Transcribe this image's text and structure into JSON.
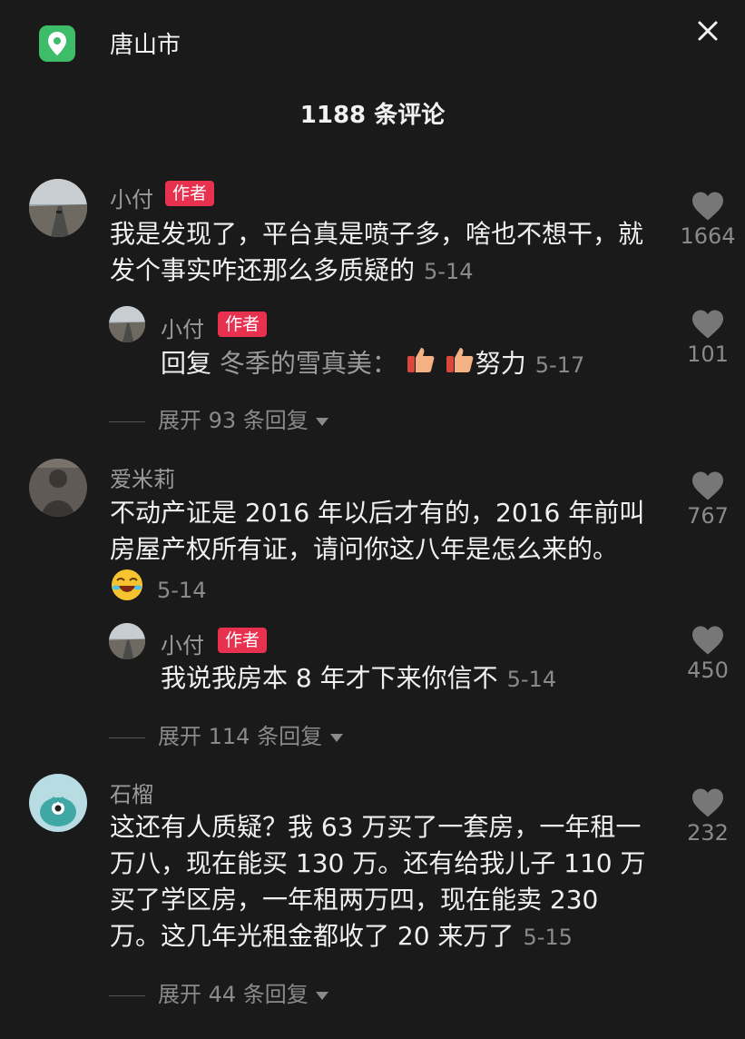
{
  "header": {
    "location": "唐山市",
    "comment_count_title": "1188 条评论"
  },
  "comments": [
    {
      "user": "小付",
      "badge": "作者",
      "text": "我是发现了，平台真是喷子多，啥也不想干，就发个事实咋还那么多质疑的",
      "date": "5-14",
      "likes": "1664",
      "reply": {
        "user": "小付",
        "badge": "作者",
        "prefix": "回复",
        "target": "冬季的雪真美：",
        "text": "努力",
        "date": "5-17",
        "likes": "101"
      },
      "expand": "展开 93 条回复"
    },
    {
      "user": "爱米莉",
      "text": "不动产证是 2016 年以后才有的，2016 年前叫房屋产权所有证，请问你这八年是怎么来的。",
      "date": "5-14",
      "likes": "767",
      "reply": {
        "user": "小付",
        "badge": "作者",
        "text": "我说我房本 8 年才下来你信不",
        "date": "5-14",
        "likes": "450"
      },
      "expand": "展开 114 条回复"
    },
    {
      "user": "石榴",
      "text": "这还有人质疑？我 63 万买了一套房，一年租一万八，现在能买 130 万。还有给我儿子 110 万买了学区房，一年租两万四，现在能卖 230 万。这几年光租金都收了 20 来万了",
      "date": "5-15",
      "likes": "232",
      "expand": "展开 44 条回复"
    }
  ],
  "colors": {
    "background": "#1a1a1a",
    "badge": "#e8304f",
    "location_icon": "#3dbd6a"
  },
  "icons": {
    "location": "map-pin-icon",
    "close": "close-icon",
    "like": "heart-icon",
    "expand": "caret-down-icon"
  }
}
